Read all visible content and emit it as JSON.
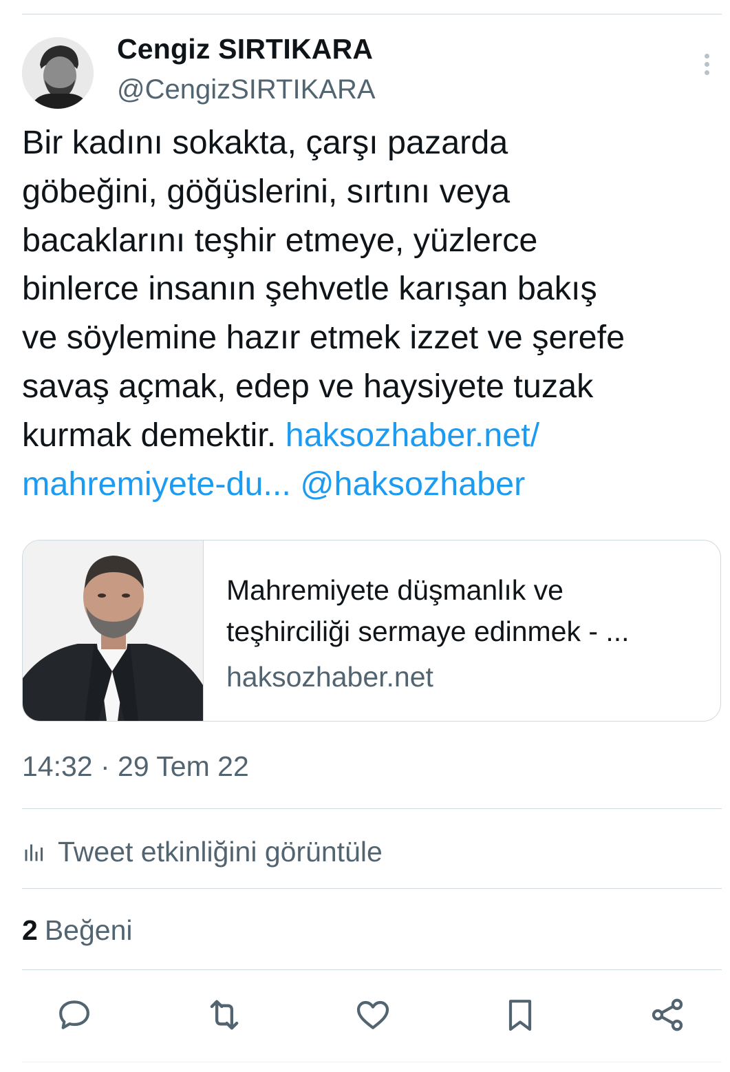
{
  "author": {
    "name": "Cengiz SIRTIKARA",
    "handle": "@CengizSIRTIKARA"
  },
  "tweet": {
    "text_lines": [
      "Bir kadını sokakta, çarşı pazarda",
      "göbeğini, göğüslerini, sırtını veya",
      "bacaklarını teşhir etmeye, yüzlerce",
      "binlerce insanın şehvetle karışan bakış",
      "ve söylemine hazır etmek izzet ve şerefe",
      "savaş açmak, edep ve haysiyete tuzak",
      "kurmak demektir."
    ],
    "link_part1": "haksozhaber.net/",
    "link_part2": "mahremiyete-du...",
    "mention": "@haksozhaber"
  },
  "card": {
    "title": "Mahremiyete düşmanlık ve\nteşhirciliği sermaye edinmek - ...",
    "domain": "haksozhaber.net"
  },
  "timestamp": "14:32 · 29 Tem 22",
  "activity": {
    "label": "Tweet etkinliğini görüntüle"
  },
  "likes": {
    "count": "2",
    "label": "Beğeni"
  },
  "colors": {
    "link": "#1d9bf0",
    "secondary_text": "#536471",
    "divider": "#cfd9de",
    "action_icon": "#536471"
  },
  "icons": {
    "more": "more-vertical-icon",
    "activity": "bar-chart-icon",
    "reply": "reply-icon",
    "retweet": "retweet-icon",
    "like": "heart-icon",
    "bookmark": "bookmark-icon",
    "share": "share-icon"
  }
}
